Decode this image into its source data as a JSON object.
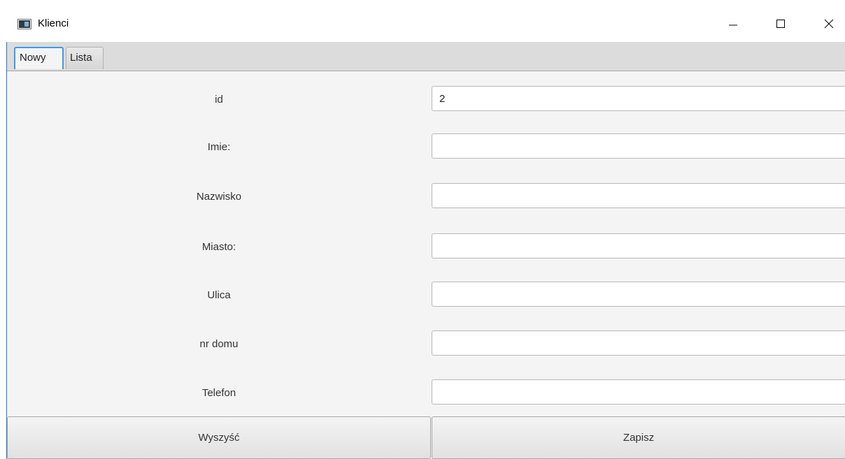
{
  "window": {
    "title": "Klienci",
    "icon": "app-window-icon",
    "controls": [
      "minimize-icon",
      "maximize-icon",
      "close-icon"
    ]
  },
  "tabs": [
    {
      "label": "Nowy",
      "selected": true
    },
    {
      "label": "Lista",
      "selected": false
    }
  ],
  "form": {
    "fields": [
      {
        "label": "id",
        "value": "2"
      },
      {
        "label": "Imie:",
        "value": ""
      },
      {
        "label": "Nazwisko",
        "value": ""
      },
      {
        "label": "Miasto:",
        "value": ""
      },
      {
        "label": "Ulica",
        "value": ""
      },
      {
        "label": "nr domu",
        "value": ""
      },
      {
        "label": "Telefon",
        "value": ""
      }
    ]
  },
  "buttons": {
    "clear_label": "Wyszyść",
    "save_label": "Zapisz"
  },
  "colors": {
    "focus_accent": "#3d9be9",
    "content_bg": "#f4f4f4",
    "tab_header_bg": "#dcdcdc"
  }
}
